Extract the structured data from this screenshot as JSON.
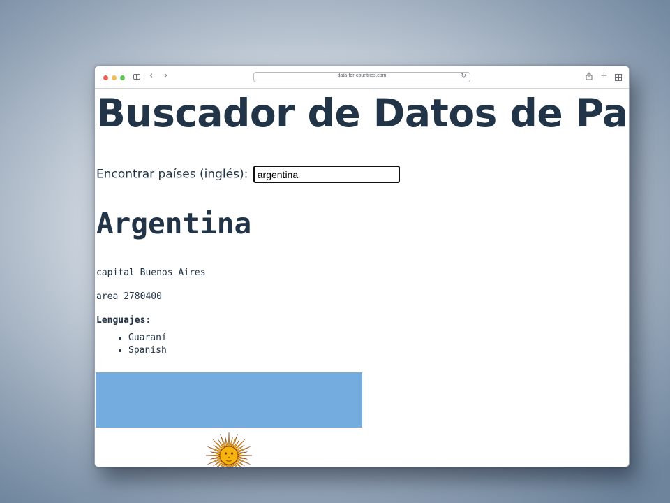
{
  "browser": {
    "url": "data-for-countries.com"
  },
  "page": {
    "title": "Buscador de Datos de País",
    "search": {
      "label": "Encontrar países (inglés):",
      "value": "argentina"
    }
  },
  "country": {
    "name": "Argentina",
    "capital_line": "capital Buenos Aires",
    "area_line": "area 2780400",
    "languages_heading": "Lenguajes:",
    "languages": [
      "Guaraní",
      "Spanish"
    ],
    "flag_colors": {
      "sky_blue": "#74acdf",
      "white": "#ffffff",
      "sun": "#f6b40e"
    }
  },
  "icons": [
    "sidebar-icon",
    "back-icon",
    "forward-icon",
    "reload-icon",
    "share-icon",
    "new-tab-icon",
    "tab-overview-icon"
  ]
}
